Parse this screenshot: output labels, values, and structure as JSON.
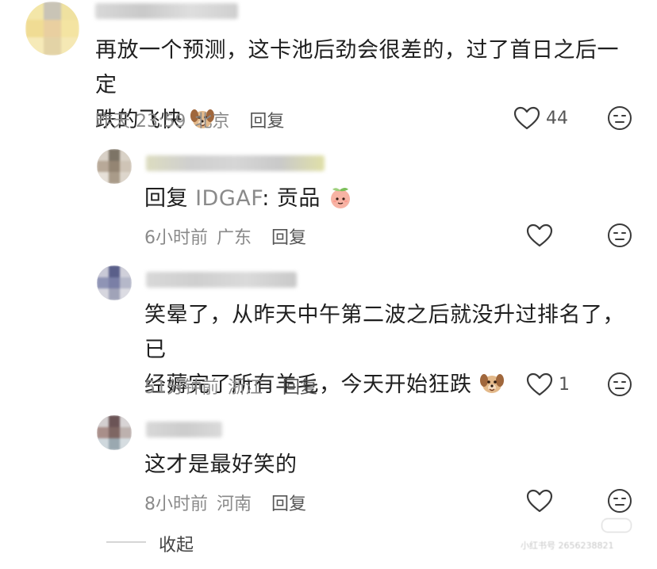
{
  "comments": [
    {
      "text_line1": "再放一个预测，这卡池后劲会很差的，过了首日之后一定",
      "text_line2": "跌的飞快",
      "time": "昨天 23:59",
      "location": "北京",
      "reply_label": "回复",
      "like_count": "44"
    }
  ],
  "replies": [
    {
      "prefix": "回复",
      "mention": "IDGAF",
      "colon_text": ": 贡品",
      "time": "6小时前",
      "location": "广东",
      "reply_label": "回复"
    },
    {
      "text_line1": "笑晕了，从昨天中午第二波之后就没升过排名了，已",
      "text_line2": "经薅完了所有羊毛，今天开始狂跌",
      "time": "51分钟前",
      "location": "浙江",
      "reply_label": "回复",
      "like_count": "1"
    },
    {
      "text_line1": "这才是最好笑的",
      "time": "8小时前",
      "location": "河南",
      "reply_label": "回复"
    }
  ],
  "collapse_label": "收起",
  "watermark": "小红书号 2656238821"
}
